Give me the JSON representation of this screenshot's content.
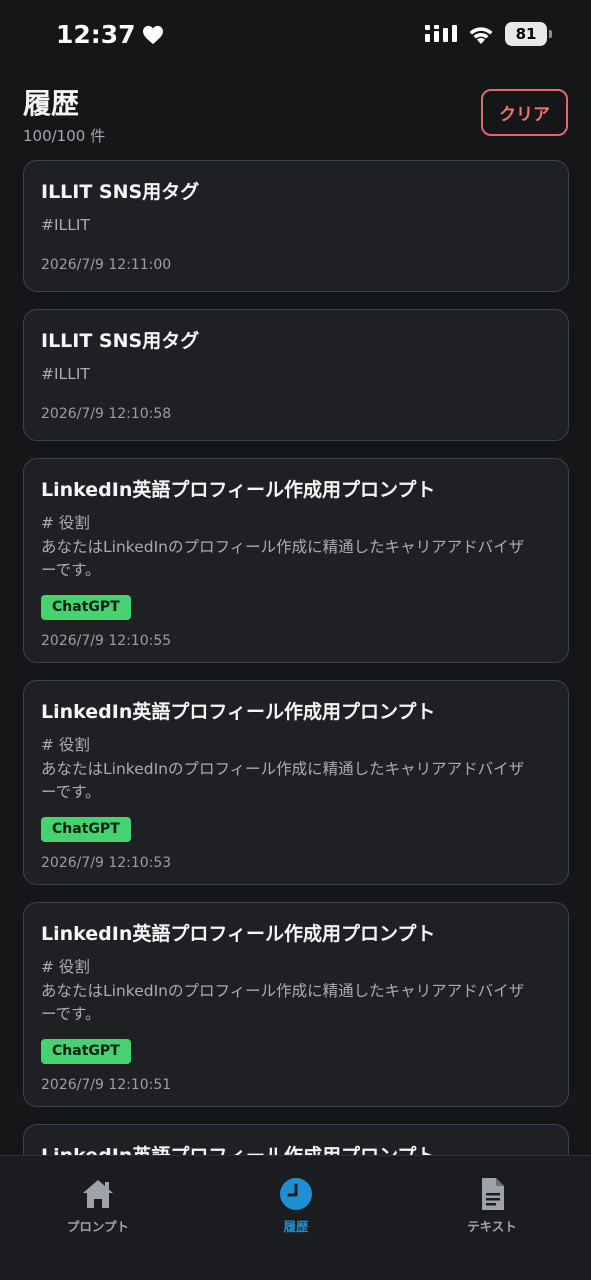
{
  "status_bar": {
    "time": "12:37",
    "battery": "81"
  },
  "header": {
    "title": "履歴",
    "count": "100/100 件",
    "clear_label": "クリア"
  },
  "history": [
    {
      "title": "ILLIT SNS用タグ",
      "body": [
        "#ILLIT"
      ],
      "tag": "",
      "date": "2026/7/9 12:11:00"
    },
    {
      "title": "ILLIT SNS用タグ",
      "body": [
        "#ILLIT"
      ],
      "tag": "",
      "date": "2026/7/9 12:10:58"
    },
    {
      "title": "LinkedIn英語プロフィール作成用プロンプト",
      "body": [
        "# 役割",
        "あなたはLinkedInのプロフィール作成に精通したキャリアアドバイザ",
        "ーです。"
      ],
      "tag": "ChatGPT",
      "date": "2026/7/9 12:10:55"
    },
    {
      "title": "LinkedIn英語プロフィール作成用プロンプト",
      "body": [
        "# 役割",
        "あなたはLinkedInのプロフィール作成に精通したキャリアアドバイザ",
        "ーです。"
      ],
      "tag": "ChatGPT",
      "date": "2026/7/9 12:10:53"
    },
    {
      "title": "LinkedIn英語プロフィール作成用プロンプト",
      "body": [
        "# 役割",
        "あなたはLinkedInのプロフィール作成に精通したキャリアアドバイザ",
        "ーです。"
      ],
      "tag": "ChatGPT",
      "date": "2026/7/9 12:10:51"
    },
    {
      "title": "LinkedIn英語プロフィール作成用プロンプト",
      "body": [],
      "tag": "",
      "date": ""
    }
  ],
  "tab_bar": {
    "items": [
      {
        "label": "プロンプト",
        "icon": "home-icon",
        "active": false
      },
      {
        "label": "履歴",
        "icon": "clock-icon",
        "active": true
      },
      {
        "label": "テキスト",
        "icon": "document-icon",
        "active": false
      }
    ]
  },
  "colors": {
    "accent_blue": "#1e8fd0",
    "clear_red": "#ef7373",
    "tag_green": "#47d271"
  }
}
